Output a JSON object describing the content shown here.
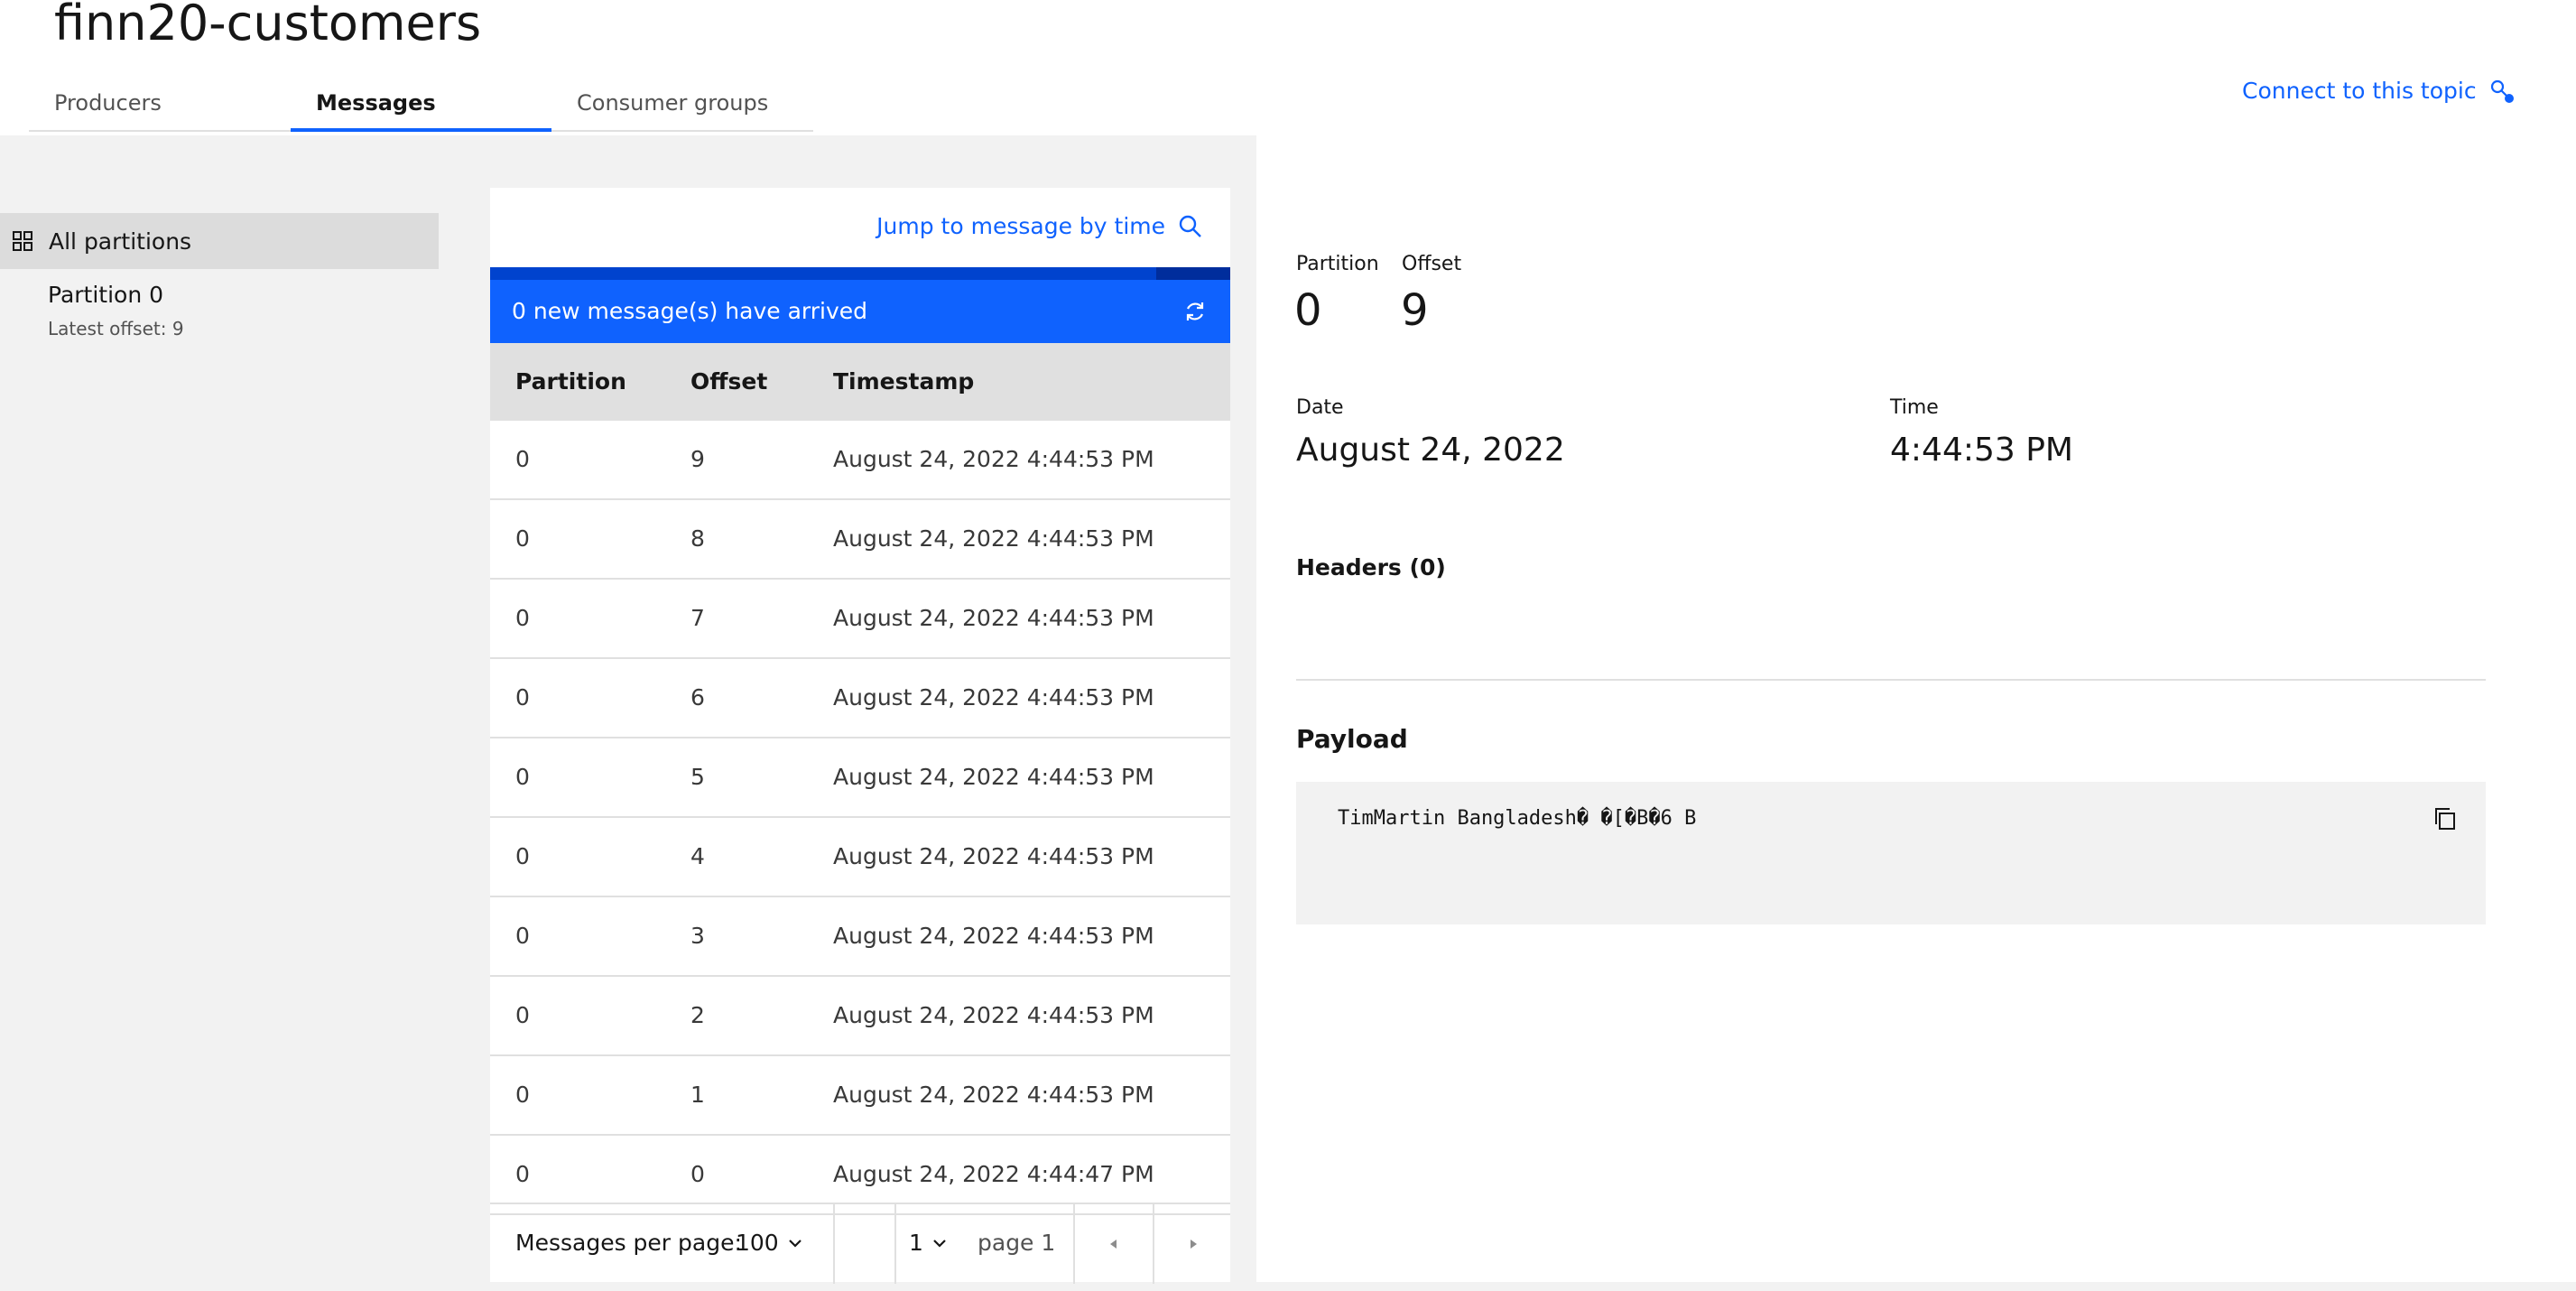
{
  "page": {
    "title": "finn20-customers"
  },
  "tabs": [
    {
      "label": "Producers",
      "selected": false
    },
    {
      "label": "Messages",
      "selected": true
    },
    {
      "label": "Consumer groups",
      "selected": false
    }
  ],
  "header": {
    "connect_label": "Connect to this topic",
    "connect_icon": "connect-key-icon"
  },
  "sidebar": {
    "all_partitions": {
      "label": "All partitions",
      "icon": "grid-icon"
    },
    "partitions": [
      {
        "label": "Partition 0",
        "sub": "Latest offset: 9"
      }
    ]
  },
  "messages": {
    "jump_label": "Jump to message by time",
    "jump_icon": "search-icon",
    "banner_text": "0 new message(s) have arrived",
    "columns": [
      "Partition",
      "Offset",
      "Timestamp"
    ],
    "rows": [
      {
        "partition": "0",
        "offset": "9",
        "timestamp": "August 24, 2022 4:44:53 PM"
      },
      {
        "partition": "0",
        "offset": "8",
        "timestamp": "August 24, 2022 4:44:53 PM"
      },
      {
        "partition": "0",
        "offset": "7",
        "timestamp": "August 24, 2022 4:44:53 PM"
      },
      {
        "partition": "0",
        "offset": "6",
        "timestamp": "August 24, 2022 4:44:53 PM"
      },
      {
        "partition": "0",
        "offset": "5",
        "timestamp": "August 24, 2022 4:44:53 PM"
      },
      {
        "partition": "0",
        "offset": "4",
        "timestamp": "August 24, 2022 4:44:53 PM"
      },
      {
        "partition": "0",
        "offset": "3",
        "timestamp": "August 24, 2022 4:44:53 PM"
      },
      {
        "partition": "0",
        "offset": "2",
        "timestamp": "August 24, 2022 4:44:53 PM"
      },
      {
        "partition": "0",
        "offset": "1",
        "timestamp": "August 24, 2022 4:44:53 PM"
      },
      {
        "partition": "0",
        "offset": "0",
        "timestamp": "August 24, 2022 4:44:47 PM"
      }
    ]
  },
  "pagination": {
    "per_page_label": "Messages per page:",
    "per_page_value": "100",
    "page_value": "1",
    "page_label": "page 1"
  },
  "detail": {
    "partition_label": "Partition",
    "partition_value": "0",
    "offset_label": "Offset",
    "offset_value": "9",
    "date_label": "Date",
    "date_value": "August 24, 2022",
    "time_label": "Time",
    "time_value": "4:44:53 PM",
    "headers_label": "Headers (0)",
    "payload_label": "Payload",
    "payload_text": "TimMartin Bangladesh� �[�B�6 B"
  },
  "colors": {
    "accent": "#0f62fe",
    "banner_bg": "#0f62fe",
    "selected_sidebar_bg": "#dcdcdc",
    "layer_bg": "#f2f2f2"
  }
}
